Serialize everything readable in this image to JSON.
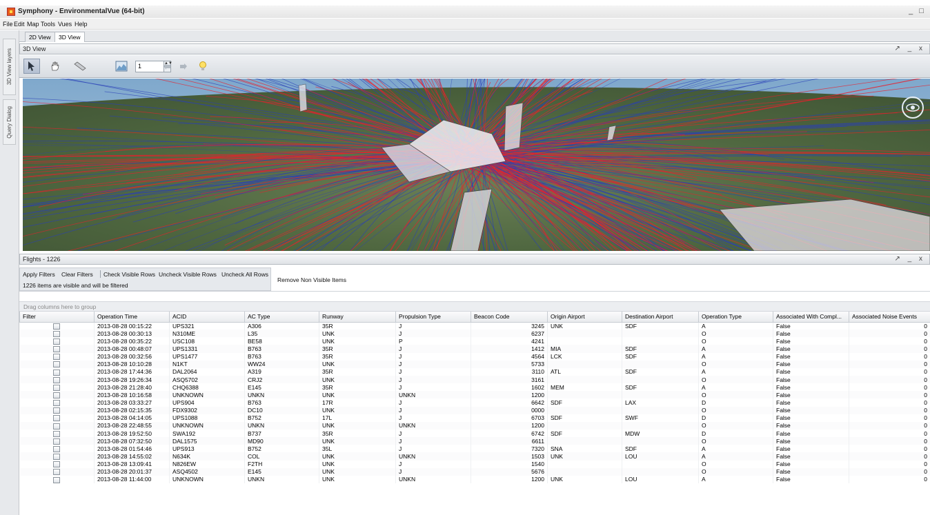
{
  "window": {
    "title": "Symphony - EnvironmentalVue (64-bit)",
    "controls": "_ □"
  },
  "menu": [
    "File",
    "Edit",
    "Map",
    "Tools",
    "Vues",
    "Help"
  ],
  "sidebar": {
    "tabs": [
      "3D View layers",
      "Query Dialog"
    ]
  },
  "view_tabs": [
    "2D View",
    "3D View"
  ],
  "view_panel": {
    "title": "3D View",
    "controls": "↗ _ x",
    "zoom_value": "1",
    "spinner_arrows": "▲▼",
    "tools": [
      "pointer-tool",
      "pan-tool",
      "measure-tool",
      "terrain-tool",
      "undo-tool",
      "redo-tool",
      "light-tool"
    ],
    "scene_colors": {
      "arrival_tracks": "#e8202c",
      "departure_tracks": "#2a3fb8",
      "sky": "#7fa6c8"
    }
  },
  "flights_panel": {
    "title": "Flights - 1226",
    "controls": "↗ _ x",
    "filter_buttons": [
      "Apply Filters",
      "Clear Filters",
      "Check Visible Rows",
      "Uncheck Visible Rows",
      "Uncheck All Rows"
    ],
    "status": "1226 items are visible and will be filtered",
    "remove_button": "Remove Non Visible Items",
    "group_hint": "Drag columns here to group"
  },
  "table": {
    "columns": [
      "Filter",
      "Operation Time",
      "ACID",
      "AC Type",
      "Runway",
      "Propulsion Type",
      "Beacon Code",
      "Origin Airport",
      "Destination Airport",
      "Operation Type",
      "Associated With Compl...",
      "Associated Noise Events"
    ],
    "rows": [
      [
        "2013-08-28 00:15:22",
        "UPS321",
        "A306",
        "35R",
        "J",
        "3245",
        "UNK",
        "SDF",
        "A",
        "False",
        "0"
      ],
      [
        "2013-08-28 00:30:13",
        "N310ME",
        "L35",
        "UNK",
        "J",
        "6237",
        "",
        "",
        "O",
        "False",
        "0"
      ],
      [
        "2013-08-28 00:35:22",
        "USC108",
        "BE58",
        "UNK",
        "P",
        "4241",
        "",
        "",
        "O",
        "False",
        "0"
      ],
      [
        "2013-08-28 00:48:07",
        "UPS1331",
        "B763",
        "35R",
        "J",
        "1412",
        "MIA",
        "SDF",
        "A",
        "False",
        "0"
      ],
      [
        "2013-08-28 00:32:56",
        "UPS1477",
        "B763",
        "35R",
        "J",
        "4564",
        "LCK",
        "SDF",
        "A",
        "False",
        "0"
      ],
      [
        "2013-08-28 10:10:28",
        "N1KT",
        "WW24",
        "UNK",
        "J",
        "5733",
        "",
        "",
        "O",
        "False",
        "0"
      ],
      [
        "2013-08-28 17:44:36",
        "DAL2064",
        "A319",
        "35R",
        "J",
        "3110",
        "ATL",
        "SDF",
        "A",
        "False",
        "0"
      ],
      [
        "2013-08-28 19:26:34",
        "ASQ5702",
        "CRJ2",
        "UNK",
        "J",
        "3161",
        "",
        "",
        "O",
        "False",
        "0"
      ],
      [
        "2013-08-28 21:28:40",
        "CHQ6388",
        "E145",
        "35R",
        "J",
        "1602",
        "MEM",
        "SDF",
        "A",
        "False",
        "0"
      ],
      [
        "2013-08-28 10:16:58",
        "UNKNOWN",
        "UNKN",
        "UNK",
        "UNKN",
        "1200",
        "",
        "",
        "O",
        "False",
        "0"
      ],
      [
        "2013-08-28 03:33:27",
        "UPS904",
        "B763",
        "17R",
        "J",
        "6642",
        "SDF",
        "LAX",
        "D",
        "False",
        "0"
      ],
      [
        "2013-08-28 02:15:35",
        "FDX9302",
        "DC10",
        "UNK",
        "J",
        "0000",
        "",
        "",
        "O",
        "False",
        "0"
      ],
      [
        "2013-08-28 04:14:05",
        "UPS1088",
        "B752",
        "17L",
        "J",
        "6703",
        "SDF",
        "SWF",
        "D",
        "False",
        "0"
      ],
      [
        "2013-08-28 22:48:55",
        "UNKNOWN",
        "UNKN",
        "UNK",
        "UNKN",
        "1200",
        "",
        "",
        "O",
        "False",
        "0"
      ],
      [
        "2013-08-28 19:52:50",
        "SWA192",
        "B737",
        "35R",
        "J",
        "6742",
        "SDF",
        "MDW",
        "D",
        "False",
        "0"
      ],
      [
        "2013-08-28 07:32:50",
        "DAL1575",
        "MD90",
        "UNK",
        "J",
        "6611",
        "",
        "",
        "O",
        "False",
        "0"
      ],
      [
        "2013-08-28 01:54:46",
        "UPS913",
        "B752",
        "35L",
        "J",
        "7320",
        "SNA",
        "SDF",
        "A",
        "False",
        "0"
      ],
      [
        "2013-08-28 14:55:02",
        "N634K",
        "COL",
        "UNK",
        "UNKN",
        "1503",
        "UNK",
        "LOU",
        "A",
        "False",
        "0"
      ],
      [
        "2013-08-28 13:09:41",
        "N826EW",
        "F2TH",
        "UNK",
        "J",
        "1540",
        "",
        "",
        "O",
        "False",
        "0"
      ],
      [
        "2013-08-28 20:01:37",
        "ASQ4502",
        "E145",
        "UNK",
        "J",
        "5676",
        "",
        "",
        "O",
        "False",
        "0"
      ],
      [
        "2013-08-28 11:44:00",
        "UNKNOWN",
        "UNKN",
        "UNK",
        "UNKN",
        "1200",
        "UNK",
        "LOU",
        "A",
        "False",
        "0"
      ]
    ]
  }
}
